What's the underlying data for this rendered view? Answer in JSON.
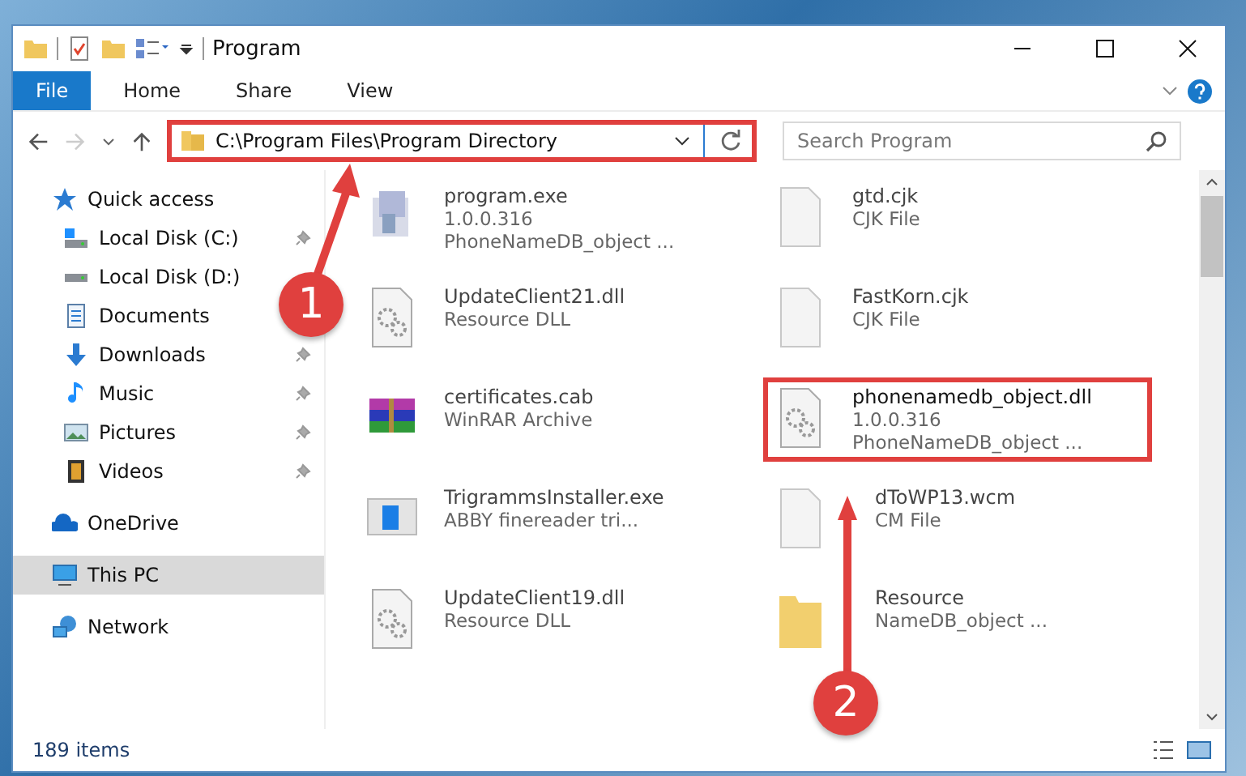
{
  "window": {
    "title": "Program"
  },
  "ribbon_tabs": [
    {
      "label": "File",
      "selected": true
    },
    {
      "label": "Home",
      "selected": false
    },
    {
      "label": "Share",
      "selected": false
    },
    {
      "label": "View",
      "selected": false
    }
  ],
  "address": {
    "path": "C:\\Program Files\\Program Directory",
    "highlighted": true
  },
  "search": {
    "placeholder": "Search Program"
  },
  "sidebar": {
    "items": [
      {
        "label": "Quick access",
        "kind": "star",
        "selected": false,
        "children": [
          {
            "label": "Local Disk (C:)",
            "kind": "drive-c",
            "pinned": true,
            "selected": false
          },
          {
            "label": "Local Disk (D:)",
            "kind": "drive",
            "pinned": false,
            "selected": false
          },
          {
            "label": "Documents",
            "kind": "documents",
            "pinned": false,
            "selected": false
          },
          {
            "label": "Downloads",
            "kind": "downloads",
            "pinned": true,
            "selected": false
          },
          {
            "label": "Music",
            "kind": "music",
            "pinned": true,
            "selected": false
          },
          {
            "label": "Pictures",
            "kind": "pictures",
            "pinned": true,
            "selected": false
          },
          {
            "label": "Videos",
            "kind": "videos",
            "pinned": true,
            "selected": false
          }
        ]
      },
      {
        "label": "OneDrive",
        "kind": "cloud",
        "selected": false
      },
      {
        "label": "This PC",
        "kind": "pc",
        "selected": true
      },
      {
        "label": "Network",
        "kind": "network",
        "selected": false
      }
    ]
  },
  "files": [
    {
      "kind": "exe",
      "name": "program.exe",
      "lines": [
        "1.0.0.316",
        "PhoneNameDB_object ..."
      ],
      "highlighted": false
    },
    {
      "kind": "file",
      "name": "gtd.cjk",
      "lines": [
        "CJK File"
      ],
      "highlighted": false
    },
    {
      "kind": "dll",
      "name": "UpdateClient21.dll",
      "lines": [
        "Resource DLL"
      ],
      "highlighted": false
    },
    {
      "kind": "file",
      "name": "FastKorn.cjk",
      "lines": [
        "CJK File"
      ],
      "highlighted": false
    },
    {
      "kind": "cab",
      "name": "certificates.cab",
      "lines": [
        "WinRAR Archive"
      ],
      "highlighted": false
    },
    {
      "kind": "dll",
      "name": "phonenamedb_object.dll",
      "lines": [
        "1.0.0.316",
        "PhoneNameDB_object ..."
      ],
      "highlighted": true
    },
    {
      "kind": "installer",
      "name": "TrigrammsInstaller.exe",
      "lines": [
        "ABBY finereader tri..."
      ],
      "highlighted": false
    },
    {
      "kind": "file",
      "name": "dToWP13.wcm",
      "lines": [
        "CM File"
      ],
      "highlighted": false
    },
    {
      "kind": "dll",
      "name": "UpdateClient19.dll",
      "lines": [
        "Resource DLL"
      ],
      "highlighted": false
    },
    {
      "kind": "folder",
      "name": "Resource",
      "lines": [
        "NameDB_object ..."
      ],
      "highlighted": false
    }
  ],
  "annotations": [
    {
      "label": "1"
    },
    {
      "label": "2"
    }
  ],
  "status_bar": {
    "count": "189 items"
  }
}
